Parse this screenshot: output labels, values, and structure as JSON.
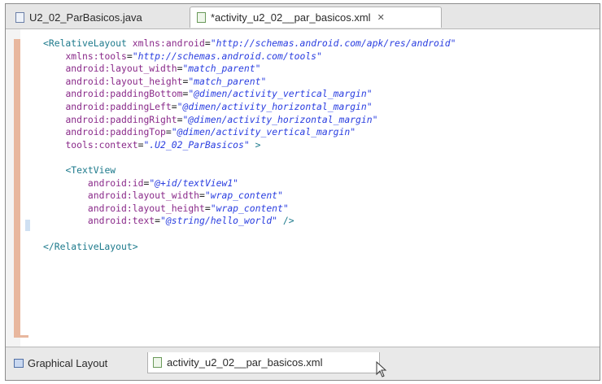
{
  "tabs": [
    {
      "label": "U2_02_ParBasicos.java",
      "icon": "java-file-icon"
    },
    {
      "label": "*activity_u2_02__par_basicos.xml",
      "icon": "xml-file-icon",
      "close": "✕"
    }
  ],
  "code_lines": [
    [
      {
        "t": "tag",
        "v": "<RelativeLayout "
      },
      {
        "t": "attr",
        "v": "xmlns:android"
      },
      {
        "t": "eq",
        "v": "="
      },
      {
        "t": "str",
        "v": "\"http://schemas.android.com/apk/res/android\""
      }
    ],
    [
      {
        "t": "plain",
        "v": "    "
      },
      {
        "t": "attr",
        "v": "xmlns:tools"
      },
      {
        "t": "eq",
        "v": "="
      },
      {
        "t": "str",
        "v": "\"http://schemas.android.com/tools\""
      }
    ],
    [
      {
        "t": "plain",
        "v": "    "
      },
      {
        "t": "attr",
        "v": "android:layout_width"
      },
      {
        "t": "eq",
        "v": "="
      },
      {
        "t": "str",
        "v": "\"match_parent\""
      }
    ],
    [
      {
        "t": "plain",
        "v": "    "
      },
      {
        "t": "attr",
        "v": "android:layout_height"
      },
      {
        "t": "eq",
        "v": "="
      },
      {
        "t": "str",
        "v": "\"match_parent\""
      }
    ],
    [
      {
        "t": "plain",
        "v": "    "
      },
      {
        "t": "attr",
        "v": "android:paddingBottom"
      },
      {
        "t": "eq",
        "v": "="
      },
      {
        "t": "str",
        "v": "\"@dimen/activity_vertical_margin\""
      }
    ],
    [
      {
        "t": "plain",
        "v": "    "
      },
      {
        "t": "attr",
        "v": "android:paddingLeft"
      },
      {
        "t": "eq",
        "v": "="
      },
      {
        "t": "str",
        "v": "\"@dimen/activity_horizontal_margin\""
      }
    ],
    [
      {
        "t": "plain",
        "v": "    "
      },
      {
        "t": "attr",
        "v": "android:paddingRight"
      },
      {
        "t": "eq",
        "v": "="
      },
      {
        "t": "str",
        "v": "\"@dimen/activity_horizontal_margin\""
      }
    ],
    [
      {
        "t": "plain",
        "v": "    "
      },
      {
        "t": "attr",
        "v": "android:paddingTop"
      },
      {
        "t": "eq",
        "v": "="
      },
      {
        "t": "str",
        "v": "\"@dimen/activity_vertical_margin\""
      }
    ],
    [
      {
        "t": "plain",
        "v": "    "
      },
      {
        "t": "attr",
        "v": "tools:context"
      },
      {
        "t": "eq",
        "v": "="
      },
      {
        "t": "str",
        "v": "\".U2_02_ParBasicos\""
      },
      {
        "t": "tag",
        "v": " >"
      }
    ],
    [],
    [
      {
        "t": "plain",
        "v": "    "
      },
      {
        "t": "tag",
        "v": "<TextView"
      }
    ],
    [
      {
        "t": "plain",
        "v": "        "
      },
      {
        "t": "attr",
        "v": "android:id"
      },
      {
        "t": "eq",
        "v": "="
      },
      {
        "t": "str",
        "v": "\"@+id/textView1\""
      }
    ],
    [
      {
        "t": "plain",
        "v": "        "
      },
      {
        "t": "attr",
        "v": "android:layout_width"
      },
      {
        "t": "eq",
        "v": "="
      },
      {
        "t": "str",
        "v": "\"wrap_content\""
      }
    ],
    [
      {
        "t": "plain",
        "v": "        "
      },
      {
        "t": "attr",
        "v": "android:layout_height"
      },
      {
        "t": "eq",
        "v": "="
      },
      {
        "t": "str",
        "v": "\"wrap_content\""
      }
    ],
    [
      {
        "t": "plain",
        "v": "        "
      },
      {
        "t": "attr",
        "v": "android:text"
      },
      {
        "t": "eq",
        "v": "="
      },
      {
        "t": "str",
        "v": "\"@string/hello_world\""
      },
      {
        "t": "tag",
        "v": " />"
      }
    ],
    [],
    [
      {
        "t": "tag",
        "v": "</RelativeLayout>"
      }
    ]
  ],
  "bottom_tabs": [
    {
      "label": "Graphical Layout",
      "icon": "graphical-layout-icon"
    },
    {
      "label": "activity_u2_02__par_basicos.xml",
      "icon": "xml-source-icon"
    }
  ]
}
